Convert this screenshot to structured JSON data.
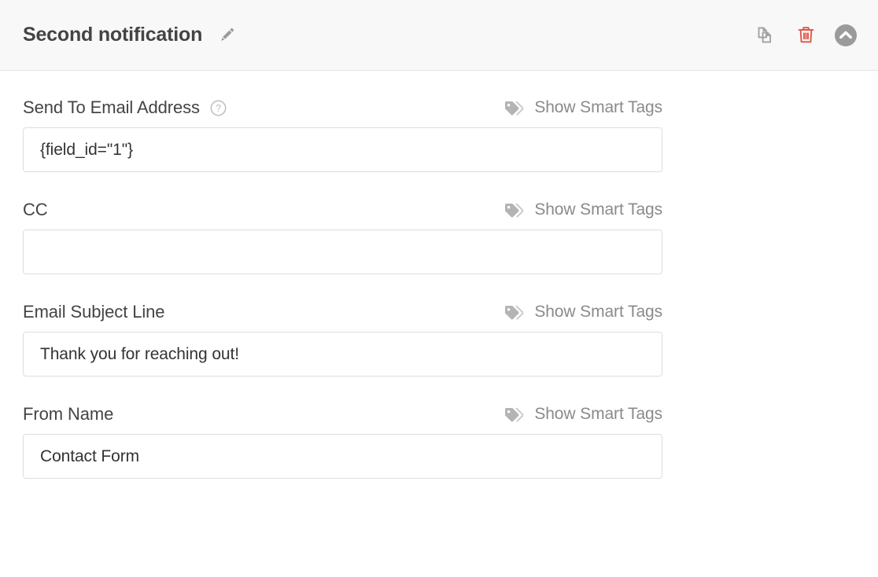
{
  "header": {
    "title": "Second notification",
    "edit_icon": "pencil-icon",
    "actions": [
      {
        "name": "duplicate-notification-button",
        "icon": "copy-icon",
        "color": "#a0a0a0"
      },
      {
        "name": "delete-notification-button",
        "icon": "trash-icon",
        "color": "#e05c4e"
      },
      {
        "name": "collapse-notification-button",
        "icon": "chevron-up-circle-icon",
        "color": "#9b9b9b"
      }
    ]
  },
  "smart_tags": {
    "label": "Show Smart Tags",
    "icon": "tags-icon"
  },
  "fields": [
    {
      "id": "send-to-email-address",
      "label": "Send To Email Address",
      "has_help": true,
      "help_icon": "question-circle-icon",
      "value": "{field_id=\"1\"}",
      "placeholder": ""
    },
    {
      "id": "cc",
      "label": "CC",
      "has_help": false,
      "value": "",
      "placeholder": ""
    },
    {
      "id": "email-subject-line",
      "label": "Email Subject Line",
      "has_help": false,
      "value": "Thank you for reaching out!",
      "placeholder": ""
    },
    {
      "id": "from-name",
      "label": "From Name",
      "has_help": false,
      "value": "Contact Form",
      "placeholder": ""
    }
  ],
  "colors": {
    "header_bg": "#f8f8f8",
    "text_dark": "#444444",
    "text_muted": "#8a8a8a",
    "border": "#dddddd",
    "danger": "#e05c4e"
  }
}
